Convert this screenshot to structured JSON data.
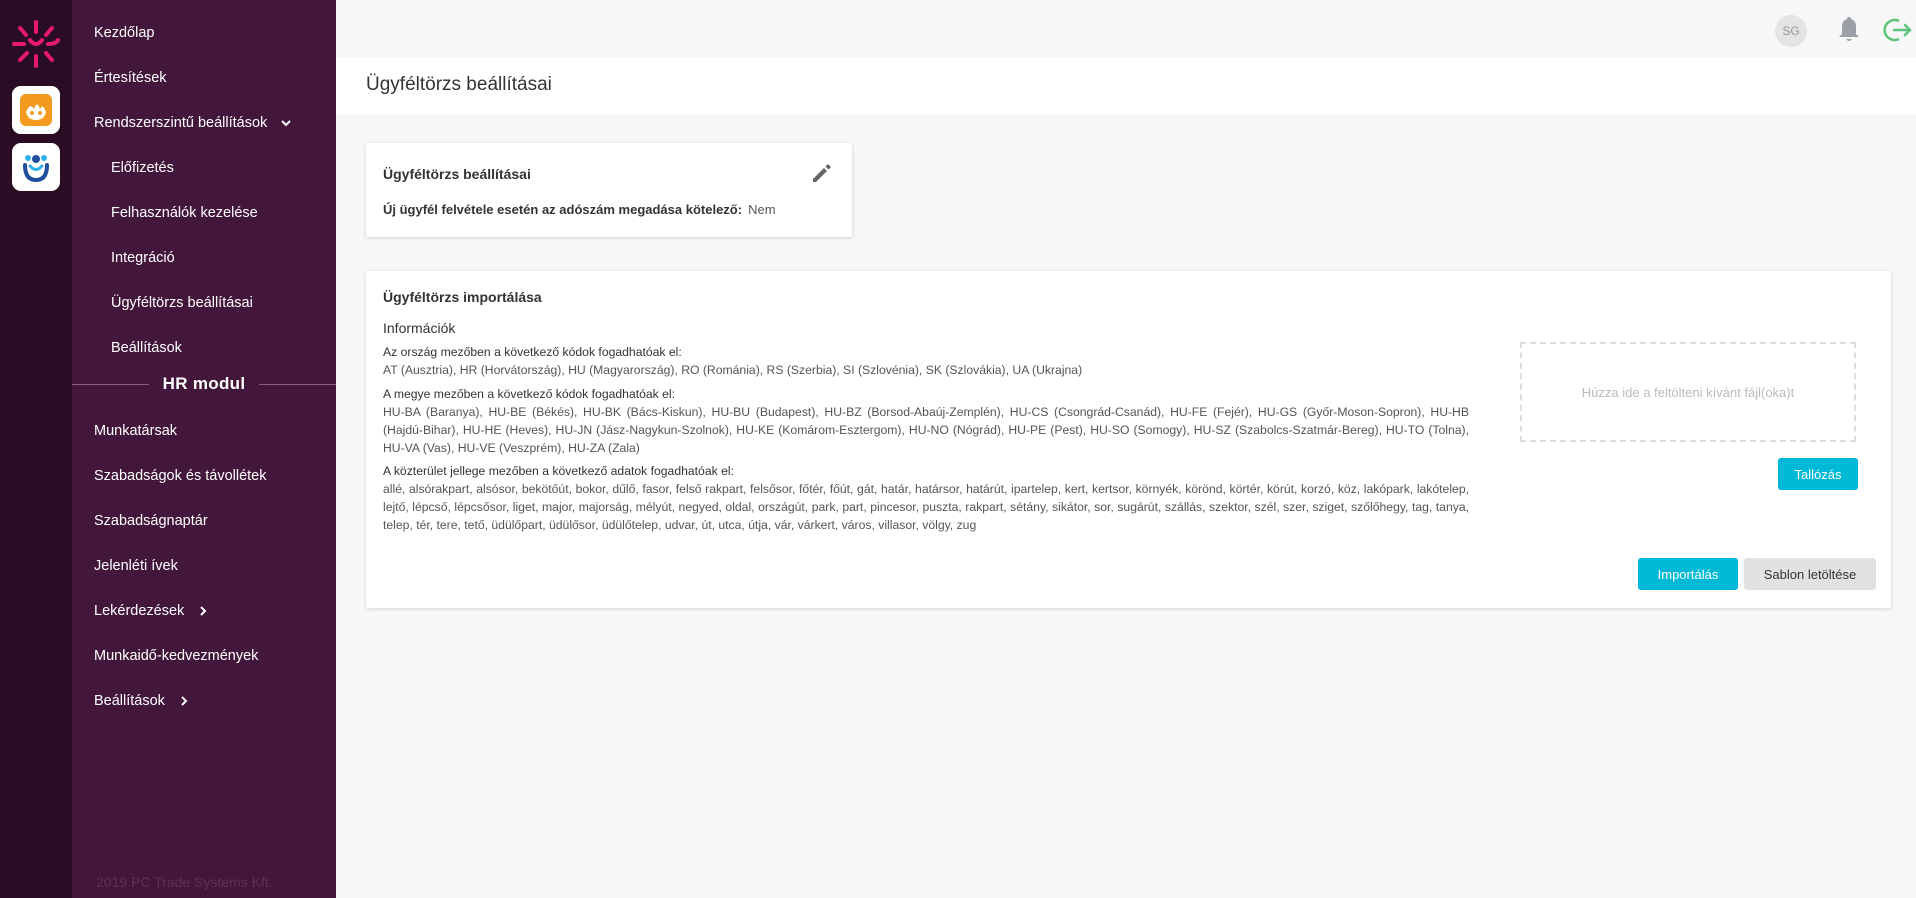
{
  "sidebar": {
    "items": [
      {
        "label": "Kezdőlap"
      },
      {
        "label": "Értesítések"
      },
      {
        "label": "Rendszerszintű beállítások"
      },
      {
        "label": "Előfizetés"
      },
      {
        "label": "Felhasználók kezelése"
      },
      {
        "label": "Integráció"
      },
      {
        "label": "Ügyféltörzs beállításai"
      },
      {
        "label": "Beállítások"
      }
    ],
    "section_title": "HR modul",
    "hr_items": [
      {
        "label": "Munkatársak"
      },
      {
        "label": "Szabadságok és távollétek"
      },
      {
        "label": "Szabadságnaptár"
      },
      {
        "label": "Jelenléti ívek"
      },
      {
        "label": "Lekérdezések"
      },
      {
        "label": "Munkaidő-kedvezmények"
      },
      {
        "label": "Beállítások"
      }
    ],
    "copyright": "2019 PC Trade Systems Kft."
  },
  "header": {
    "avatar_initials": "SG"
  },
  "page": {
    "title": "Ügyféltörzs beállításai"
  },
  "settings_card": {
    "title": "Ügyféltörzs beállításai",
    "tax_label": "Új ügyfél felvétele esetén az adószám megadása kötelező:",
    "tax_value": "Nem"
  },
  "import_card": {
    "title": "Ügyféltörzs importálása",
    "info_title": "Információk",
    "country_heading": "Az ország mezőben a következő kódok fogadhatóak el:",
    "country_codes": "AT (Ausztria), HR (Horvátország), HU (Magyarország), RO (Románia), RS (Szerbia), SI (Szlovénia), SK (Szlovákia), UA (Ukrajna)",
    "county_heading": "A megye mezőben a következő kódok fogadhatóak el:",
    "county_codes": "HU-BA (Baranya), HU-BE (Békés), HU-BK (Bács-Kiskun), HU-BU (Budapest), HU-BZ (Borsod-Abaúj-Zemplén), HU-CS (Csongrád-Csanád), HU-FE (Fejér), HU-GS (Győr-Moson-Sopron), HU-HB (Hajdú-Bihar), HU-HE (Heves), HU-JN (Jász-Nagykun-Szolnok), HU-KE (Komárom-Esztergom), HU-NO (Nógrád), HU-PE (Pest), HU-SO (Somogy), HU-SZ (Szabolcs-Szatmár-Bereg), HU-TO (Tolna), HU-VA (Vas), HU-VE (Veszprém), HU-ZA (Zala)",
    "street_heading": "A közterület jellege mezőben a következő adatok fogadhatóak el:",
    "street_types": "allé, alsórakpart, alsósor, bekötőút, bokor, dűlő, fasor, felső rakpart, felsősor, főtér, főút, gát, határ, határsor, határút, ipartelep, kert, kertsor, környék, körönd, körtér, körút, korzó, köz, lakópark, lakótelep, lejtő, lépcső, lépcsősor, liget, major, majorság, mélyút, negyed, oldal, országút, park, part, pincesor, puszta, rakpart, sétány, sikátor, sor, sugárút, szállás, szektor, szél, szer, sziget, szőlőhegy, tag, tanya, telep, tér, tere, tető, üdülőpart, üdülősor, üdülőtelep, udvar, út, utca, útja, vár, várkert, város, villasor, völgy, zug",
    "dropzone_text": "Húzza ide a feltölteni kívánt fájl(oka)t",
    "browse_label": "Tallózás",
    "import_label": "Importálás",
    "template_label": "Sablon letöltése"
  },
  "colors": {
    "rail": "#2a0c24",
    "sidebar": "#43163b",
    "accent": "#00b9d6",
    "logo": "#e6196e"
  }
}
